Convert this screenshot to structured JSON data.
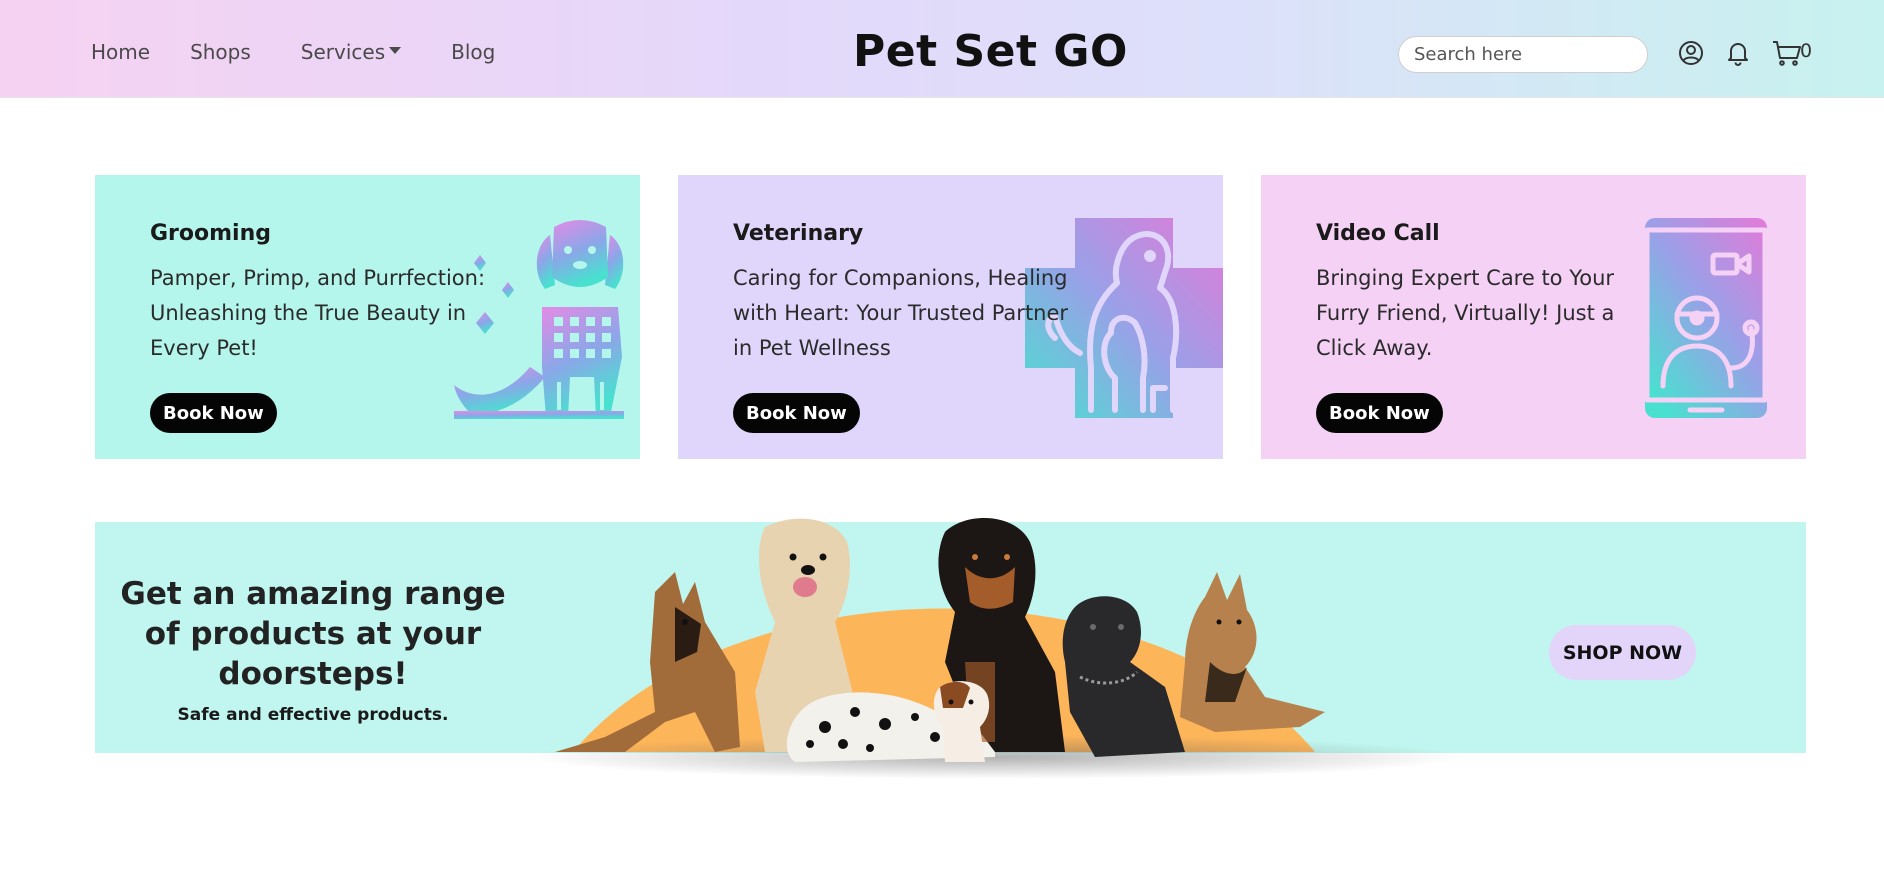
{
  "nav": {
    "links": [
      "Home",
      "Shops",
      "Services",
      "Blog"
    ],
    "brand": "Pet Set GO",
    "search_placeholder": "Search here",
    "cart_count": "0"
  },
  "services": [
    {
      "title": "Grooming",
      "text": "Pamper, Primp, and Purrfection: Unleashing the True Beauty in Every Pet!",
      "button": "Book Now",
      "icon": "dog-grooming-icon",
      "bg": "#b4f5ec"
    },
    {
      "title": "Veterinary",
      "text": "Caring for Companions, Healing with Heart: Your Trusted Partner in Pet Wellness",
      "button": "Book Now",
      "icon": "veterinary-cross-icon",
      "bg": "#e0d6fb"
    },
    {
      "title": "Video Call",
      "text": "Bringing Expert Care to Your Furry Friend, Virtually! Just a Click Away.",
      "button": "Book Now",
      "icon": "video-call-phone-icon",
      "bg": "#f4d1f5"
    }
  ],
  "promo": {
    "headline": "Get an amazing range of products at your doorsteps!",
    "subtext": "Safe and effective products.",
    "button": "SHOP NOW",
    "bg": "#c0f6ef"
  },
  "colors": {
    "accent_sun": "#fdb55a",
    "icon_gradient_start": "#e48ae6",
    "icon_gradient_end": "#49e0d0"
  }
}
